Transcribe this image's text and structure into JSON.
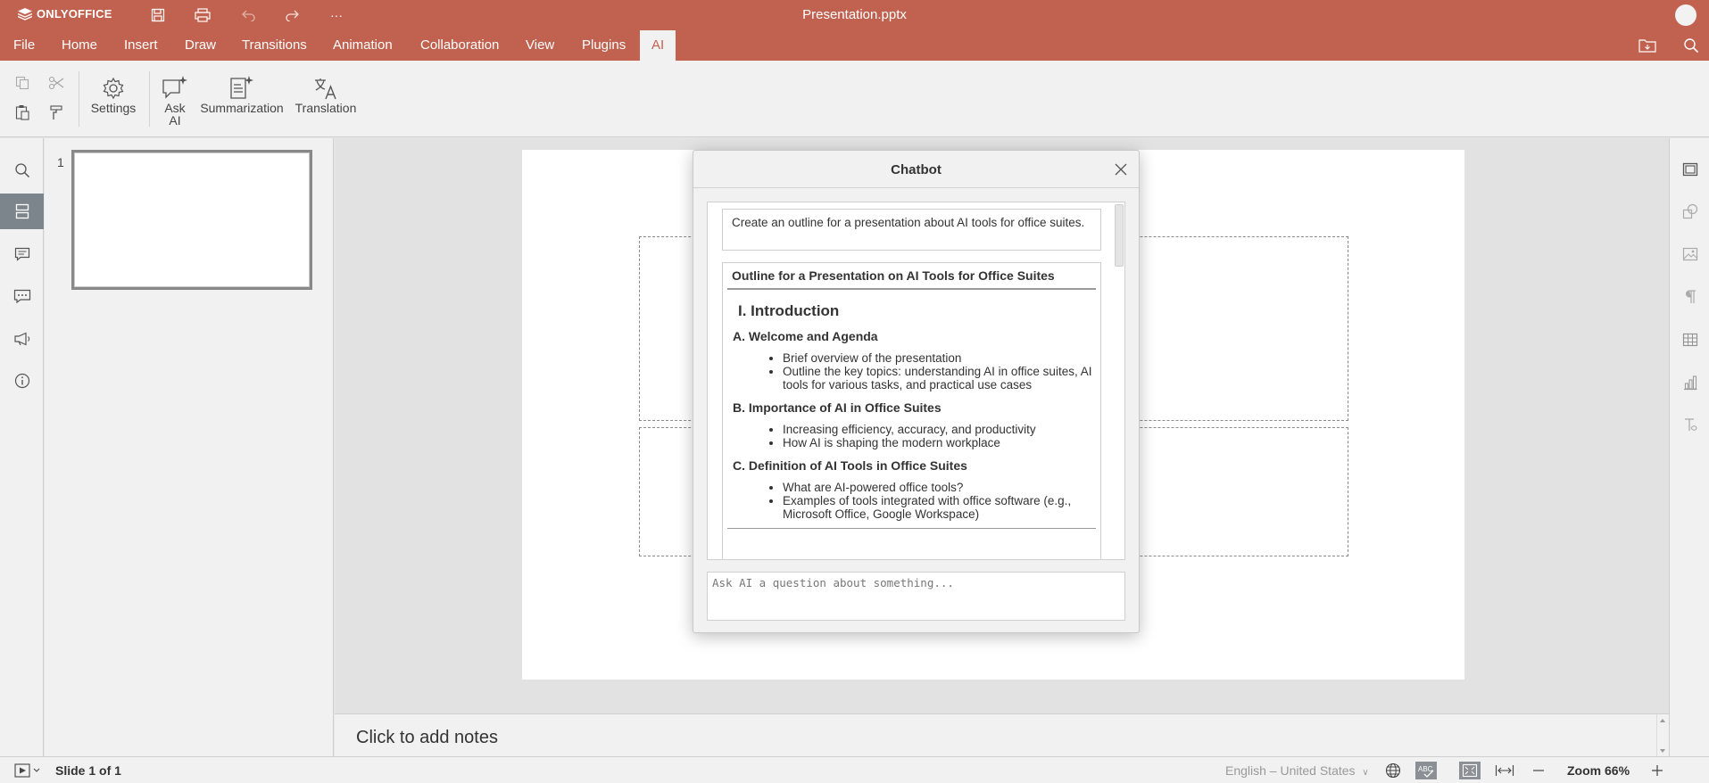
{
  "app": {
    "brand": "ONLYOFFICE",
    "document_title": "Presentation.pptx",
    "accent_color": "#c0624f"
  },
  "quick_access": [
    "save-icon",
    "print-icon",
    "undo-icon",
    "redo-icon",
    "more-icon"
  ],
  "quick_more": "···",
  "menu": {
    "tabs": [
      "File",
      "Home",
      "Insert",
      "Draw",
      "Transitions",
      "Animation",
      "Collaboration",
      "View",
      "Plugins",
      "AI"
    ],
    "active_tab": "AI"
  },
  "toolbar": {
    "settings_label": "Settings",
    "ask_ai_label_1": "Ask",
    "ask_ai_label_2": "AI",
    "summarization_label": "Summarization",
    "translation_label": "Translation"
  },
  "thumbnails": {
    "slide_number": "1"
  },
  "chatbot": {
    "title": "Chatbot",
    "user_prompt": "Create an outline for a presentation about AI tools for office suites.",
    "response": {
      "heading": "Outline for a Presentation on AI Tools for Office Suites",
      "section": "I. Introduction",
      "sub_a": "A. Welcome and Agenda",
      "sub_a_items": [
        "Brief overview of the presentation",
        "Outline the key topics: understanding AI in office suites, AI tools for various tasks, and practical use cases"
      ],
      "sub_b": "B. Importance of AI in Office Suites",
      "sub_b_items": [
        "Increasing efficiency, accuracy, and productivity",
        "How AI is shaping the modern workplace"
      ],
      "sub_c": "C. Definition of AI Tools in Office Suites",
      "sub_c_items": [
        "What are AI-powered office tools?",
        "Examples of tools integrated with office software (e.g., Microsoft Office, Google Workspace)"
      ]
    },
    "input_placeholder": "Ask AI a question about something..."
  },
  "notes": {
    "placeholder": "Click to add notes"
  },
  "status": {
    "slide_indicator": "Slide 1 of 1",
    "language": "English – United States",
    "zoom": "Zoom 66%"
  }
}
